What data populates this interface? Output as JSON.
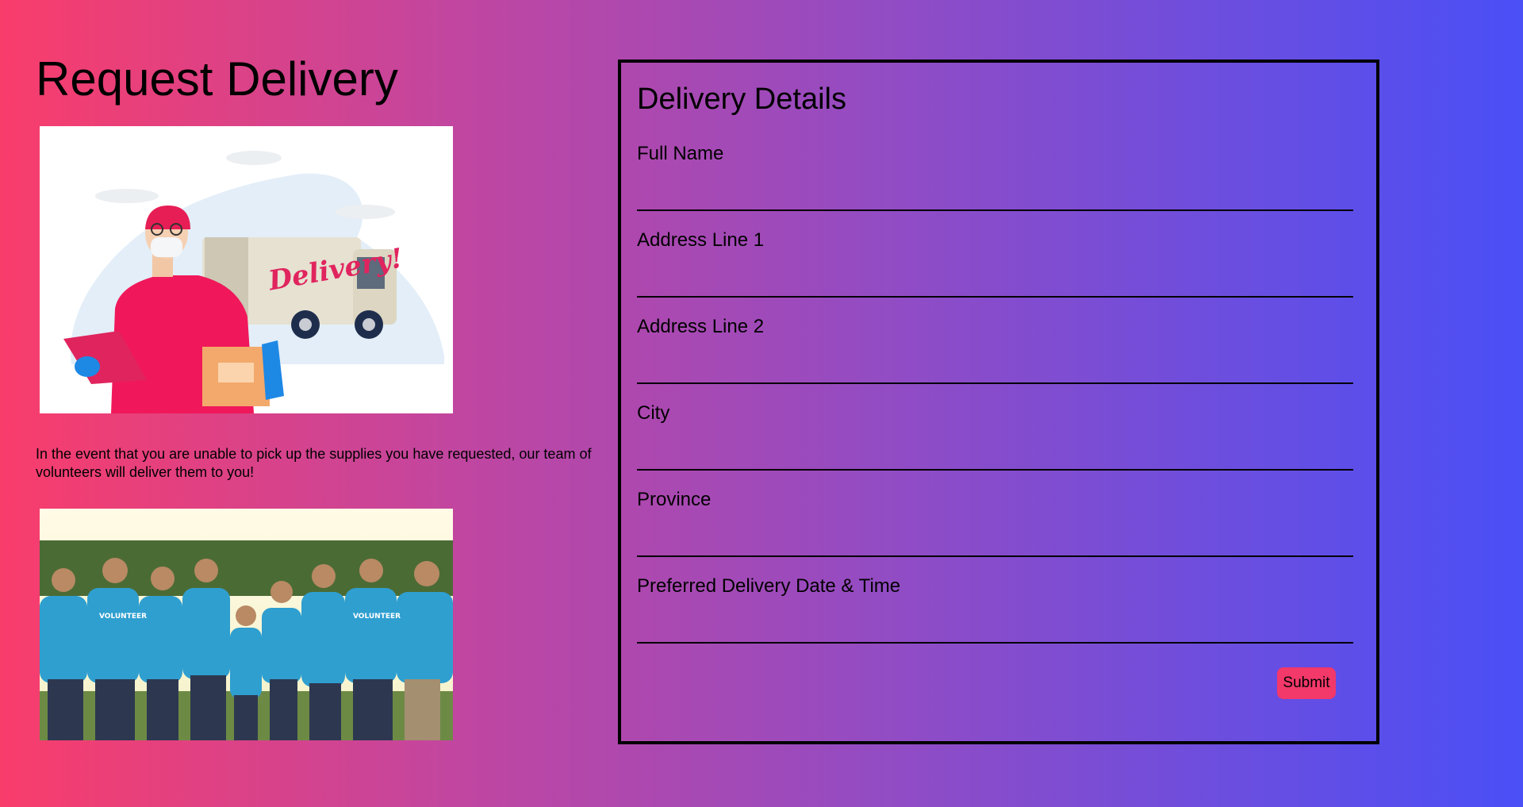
{
  "page": {
    "title": "Request Delivery",
    "intro": "In the event that you are unable to pick up the supplies you have requested, our team of volunteers will deliver them to you!"
  },
  "images": {
    "delivery": {
      "truck_text": "Delivery!"
    },
    "volunteers": {
      "shirt_text": "VOLUNTEER"
    }
  },
  "form": {
    "title": "Delivery Details",
    "fields": [
      {
        "label": "Full Name",
        "value": ""
      },
      {
        "label": "Address Line 1",
        "value": ""
      },
      {
        "label": "Address Line 2",
        "value": ""
      },
      {
        "label": "City",
        "value": ""
      },
      {
        "label": "Province",
        "value": ""
      },
      {
        "label": "Preferred Delivery Date & Time",
        "value": ""
      }
    ],
    "submit_label": "Submit"
  },
  "colors": {
    "gradient_start": "#f93d6b",
    "gradient_end": "#4a4ff6",
    "submit_bg": "#f3386a"
  }
}
